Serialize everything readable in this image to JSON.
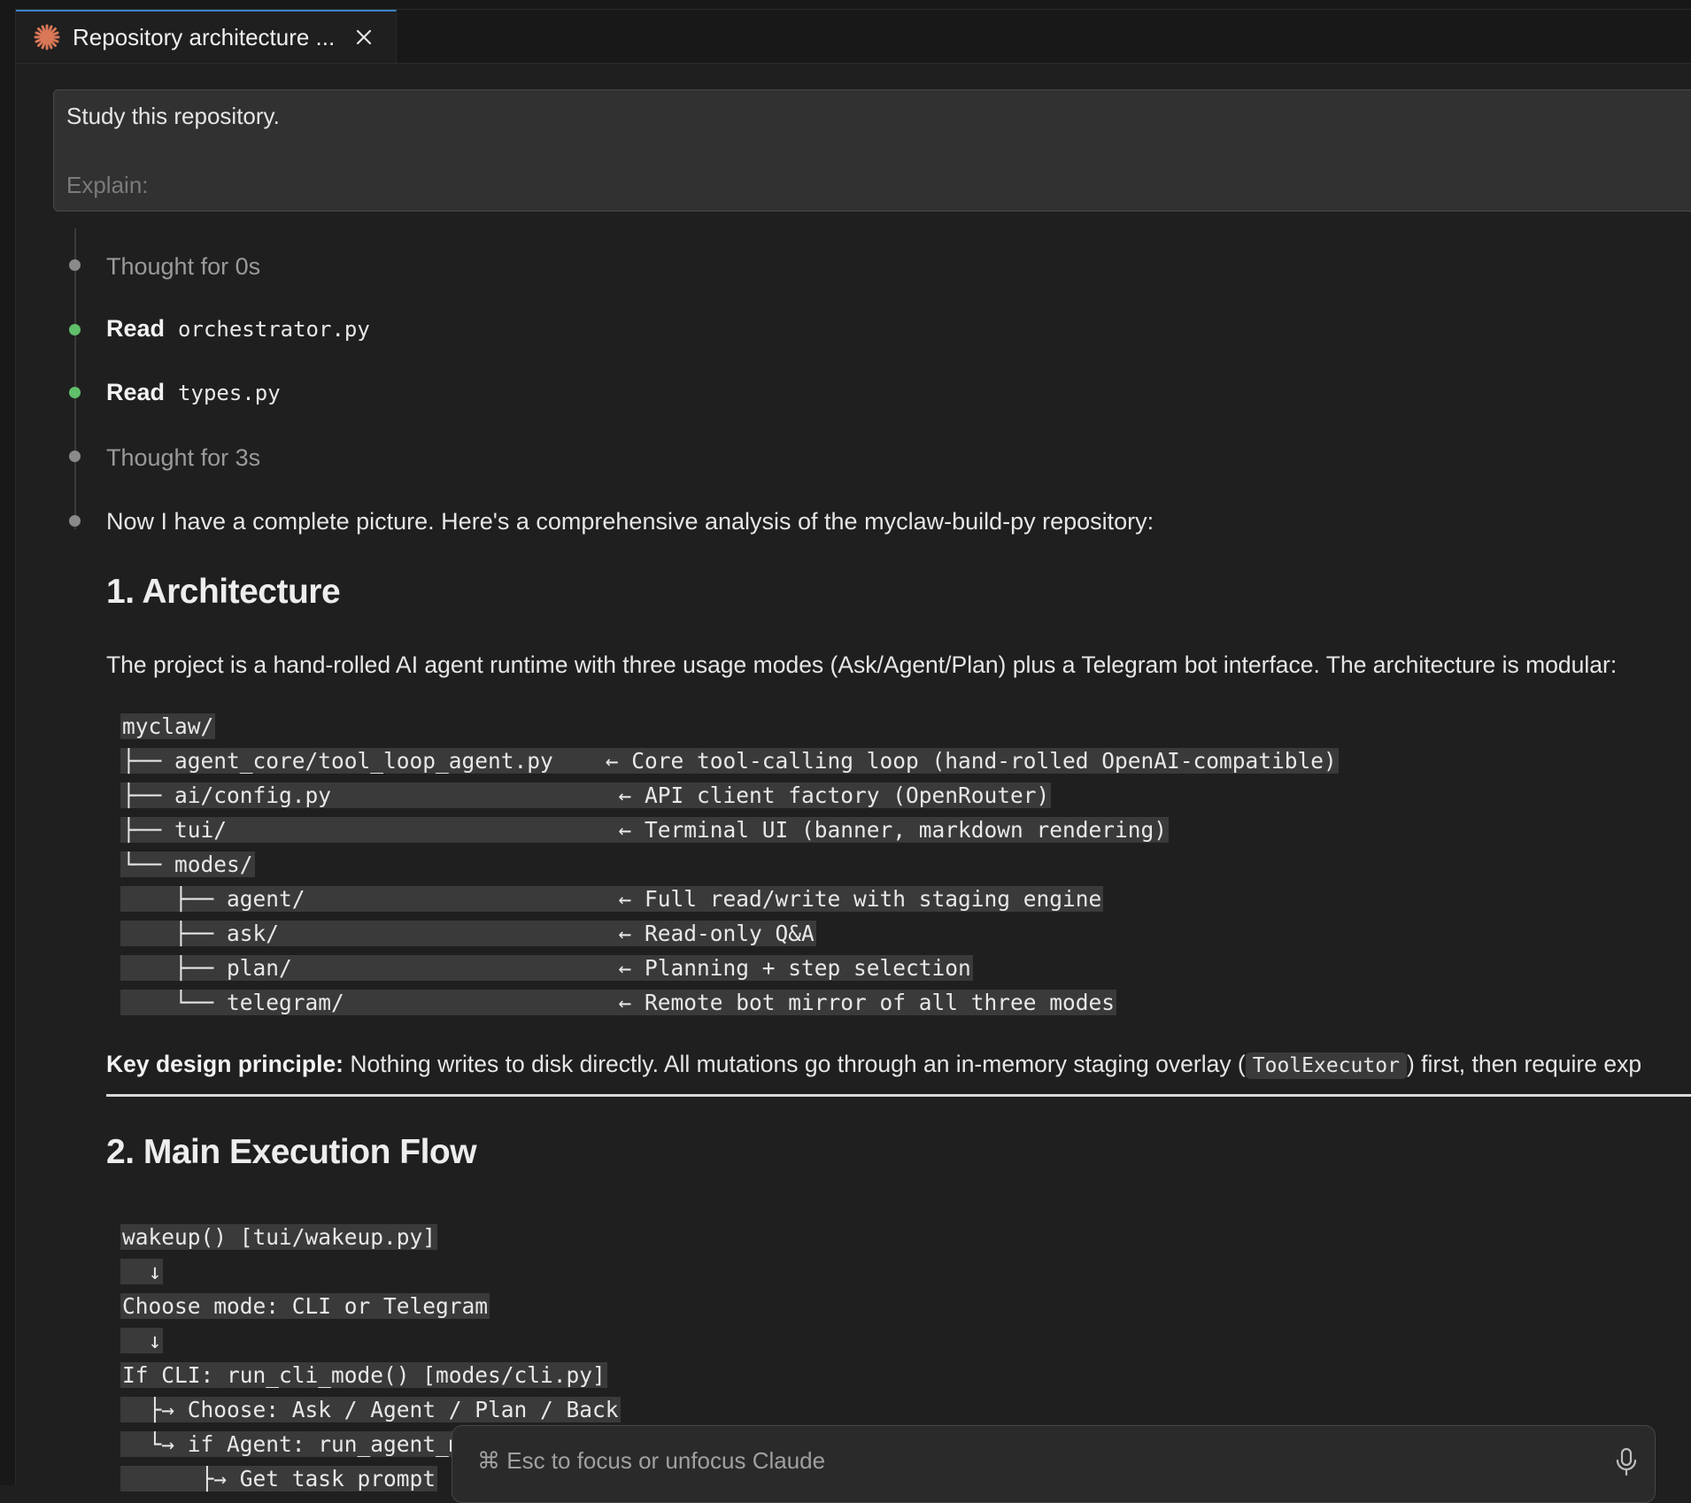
{
  "tab": {
    "title": "Repository architecture ...",
    "icon": "claude-sparkle-icon",
    "accent": "#d97757"
  },
  "prompt": {
    "line1": "Study this repository.",
    "line2": "Explain:"
  },
  "steps": [
    {
      "kind": "thought",
      "text": "Thought for 0s",
      "dot": "gray"
    },
    {
      "kind": "read",
      "verb": "Read",
      "file": "orchestrator.py",
      "dot": "green"
    },
    {
      "kind": "read",
      "verb": "Read",
      "file": "types.py",
      "dot": "green"
    },
    {
      "kind": "thought",
      "text": "Thought for 3s",
      "dot": "gray"
    },
    {
      "kind": "message",
      "text": "Now I have a complete picture. Here's a comprehensive analysis of the myclaw-build-py repository:",
      "dot": "gray"
    }
  ],
  "section1": {
    "heading": "1. Architecture",
    "intro": "The project is a hand-rolled AI agent runtime with three usage modes (Ask/Agent/Plan) plus a Telegram bot interface. The architecture is modular:",
    "tree": [
      "myclaw/",
      "├── agent_core/tool_loop_agent.py    ← Core tool-calling loop (hand-rolled OpenAI-compatible)",
      "├── ai/config.py                      ← API client factory (OpenRouter)",
      "├── tui/                              ← Terminal UI (banner, markdown rendering)",
      "└── modes/",
      "    ├── agent/                        ← Full read/write with staging engine",
      "    ├── ask/                          ← Read-only Q&A",
      "    ├── plan/                         ← Planning + step selection",
      "    └── telegram/                     ← Remote bot mirror of all three modes"
    ],
    "key_label": "Key design principle:",
    "key_text_before": " Nothing writes to disk directly. All mutations go through an in-memory staging overlay (",
    "key_code": "ToolExecutor",
    "key_text_after": ") first, then require exp"
  },
  "section2": {
    "heading": "2. Main Execution Flow",
    "flow": [
      "wakeup() [tui/wakeup.py]",
      "  ↓",
      "Choose mode: CLI or Telegram",
      "  ↓",
      "If CLI: run_cli_mode() [modes/cli.py]",
      "  ├→ Choose: Ask / Agent / Plan / Back",
      "  └→ if Agent: run_agent_mo",
      "      ├→ Get task prompt"
    ]
  },
  "bottom_input": {
    "placeholder": "⌘ Esc to focus or unfocus Claude",
    "mic_icon": "microphone-icon"
  }
}
